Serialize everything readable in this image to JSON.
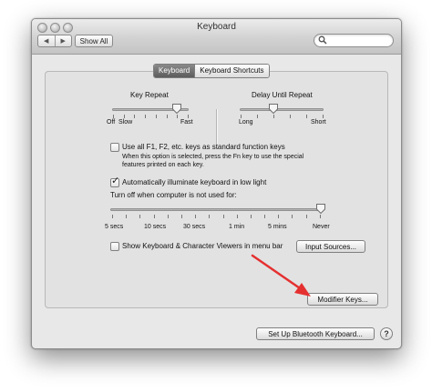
{
  "window": {
    "title": "Keyboard",
    "show_all_label": "Show All",
    "search": {
      "value": "",
      "placeholder": ""
    },
    "nav": {
      "back_glyph": "◀",
      "forward_glyph": "▶"
    }
  },
  "tabs": [
    {
      "label": "Keyboard",
      "active": true
    },
    {
      "label": "Keyboard Shortcuts",
      "active": false
    }
  ],
  "key_repeat": {
    "label": "Key Repeat",
    "min_label": "Off",
    "low_label": "Slow",
    "high_label": "Fast",
    "value_fraction": 0.85
  },
  "delay_until_repeat": {
    "label": "Delay Until Repeat",
    "low_label": "Long",
    "high_label": "Short",
    "value_fraction": 0.4
  },
  "fn_keys": {
    "checked": false,
    "label": "Use all F1, F2, etc. keys as standard function keys",
    "help_line1": "When this option is selected, press the Fn key to use the special",
    "help_line2": "features printed on each key."
  },
  "illumination": {
    "checked": true,
    "label": "Automatically illuminate keyboard in low light",
    "turn_off_label": "Turn off when computer is not used for:",
    "ticks": [
      "5 secs",
      "10 secs",
      "30 secs",
      "1 min",
      "5 mins",
      "Never"
    ],
    "value": "Never"
  },
  "viewers": {
    "checked": false,
    "label": "Show Keyboard & Character Viewers in menu bar"
  },
  "buttons": {
    "input_sources": "Input Sources...",
    "modifier_keys": "Modifier Keys...",
    "bluetooth": "Set Up Bluetooth Keyboard...",
    "help": "?"
  },
  "colors": {
    "annotation_arrow": "#e53030",
    "active_tab": "#6a6a6a"
  }
}
